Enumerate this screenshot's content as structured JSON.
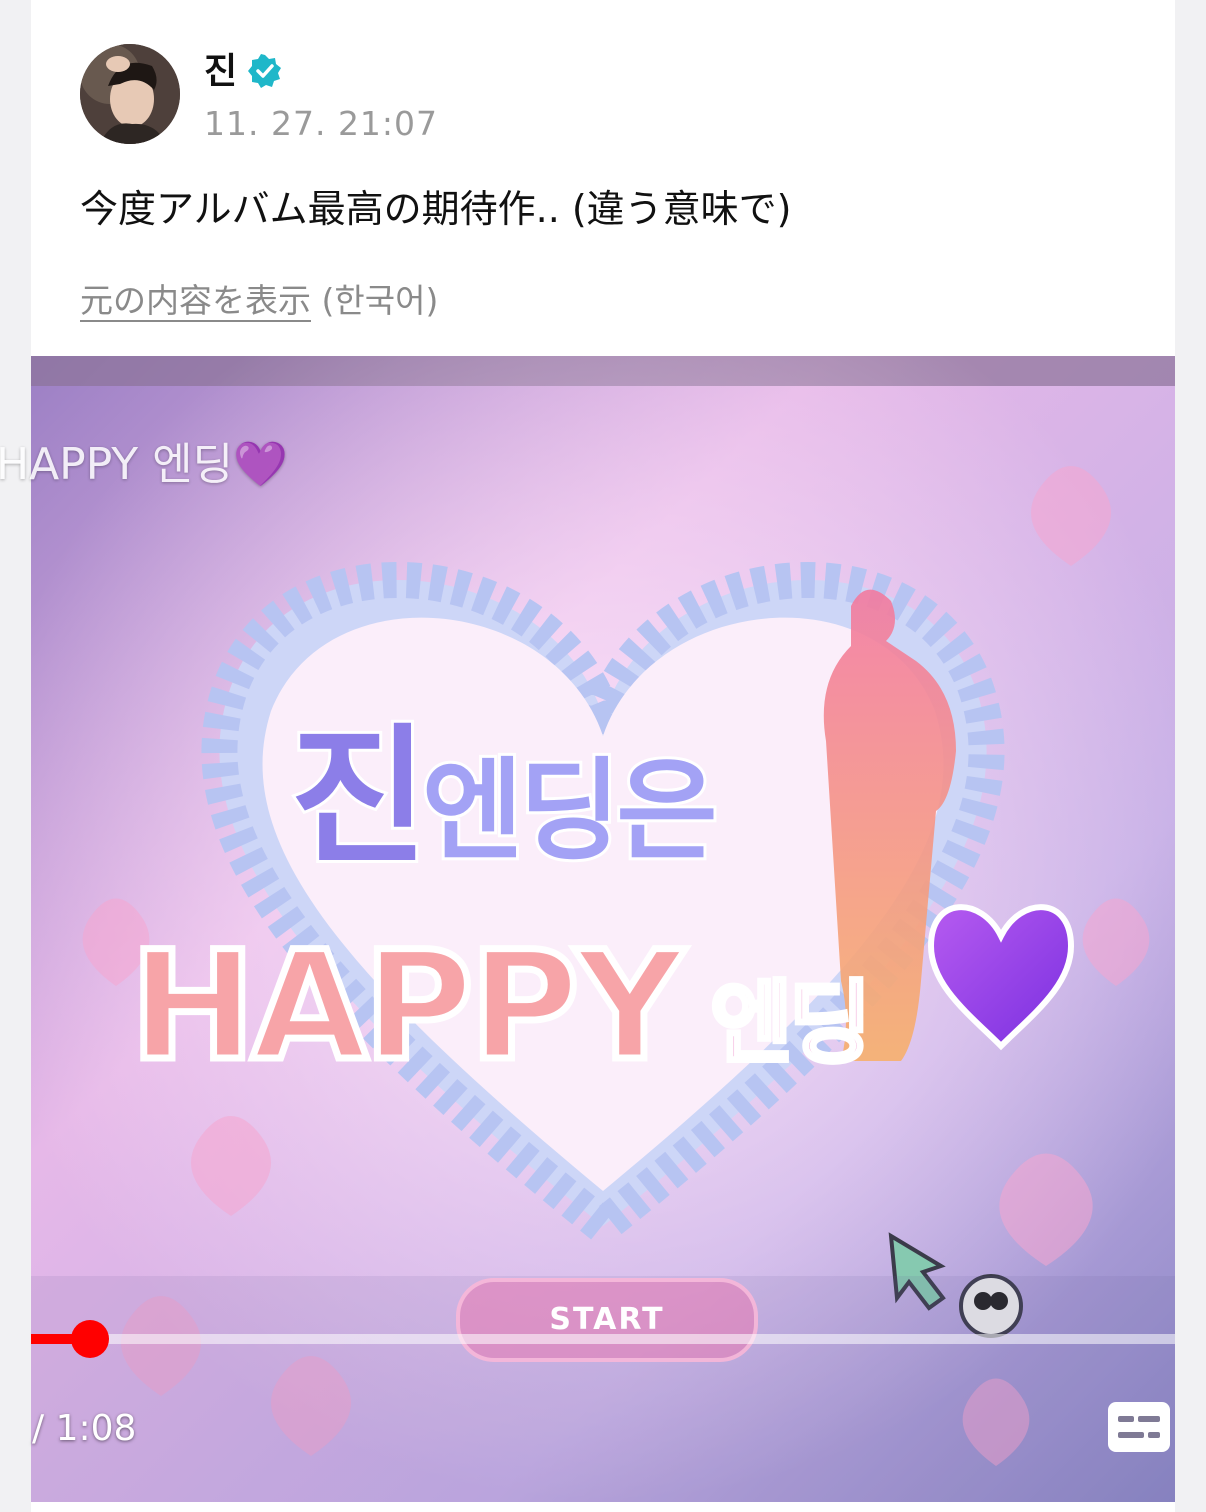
{
  "post": {
    "author_name": "진",
    "verified": true,
    "timestamp": "11. 27. 21:07",
    "text": "今度アルバム最高の期待作.. (違う意味で)",
    "translate_link": "元の内容を表示",
    "original_language": "(한국어)"
  },
  "video": {
    "overlay_title": "HAPPY 엔딩💜",
    "title_line1_big": "진",
    "title_line1_small": "엔딩은",
    "title_happy": "HAPPY",
    "title_happy_suffix": "엔딩",
    "start_label": "START",
    "time_display": "/ 1:08",
    "progress_fraction": 0.052,
    "progress_color": "#ff0000"
  },
  "colors": {
    "verified": "#1fb7c9",
    "timestamp": "#9a9a9a",
    "text": "#111111"
  }
}
